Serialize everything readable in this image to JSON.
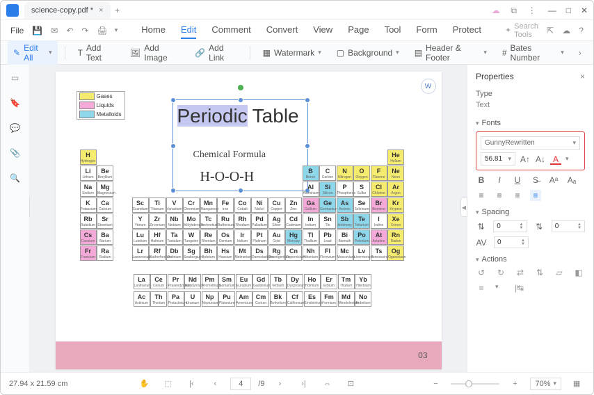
{
  "tab_title": "science-copy.pdf *",
  "menu": {
    "file": "File"
  },
  "tabs": [
    "Home",
    "Edit",
    "Comment",
    "Convert",
    "View",
    "Page",
    "Tool",
    "Form",
    "Protect"
  ],
  "active_tab": "Edit",
  "search_placeholder": "Search Tools",
  "toolbar": {
    "edit_all": "Edit All",
    "add_text": "Add Text",
    "add_image": "Add Image",
    "add_link": "Add Link",
    "watermark": "Watermark",
    "background": "Background",
    "header_footer": "Header & Footer",
    "bates": "Bates Number"
  },
  "properties": {
    "title": "Properties",
    "type_label": "Type",
    "type_value": "Text",
    "fonts_label": "Fonts",
    "font_name": "GunnyRewritten",
    "font_size": "56.81",
    "spacing_label": "Spacing",
    "spacing_before": "0",
    "spacing_after": "0",
    "char_spacing": "0",
    "actions_label": "Actions"
  },
  "doc": {
    "title_word1": "Periodic",
    "title_word2": "Table",
    "subtitle": "Chemical Formula",
    "formula": "H-O-O-H",
    "page_number": "03",
    "legend": {
      "gases": "Gases",
      "liquids": "Liquids",
      "metalloids": "Metalloids"
    },
    "elements_main": [
      {
        "s": "H",
        "n": "Hydrogen",
        "r": 0,
        "c": 0,
        "cat": "gas"
      },
      {
        "s": "He",
        "n": "Helium",
        "r": 0,
        "c": 17,
        "cat": "gas"
      },
      {
        "s": "Li",
        "n": "Lithium",
        "r": 1,
        "c": 0
      },
      {
        "s": "Be",
        "n": "Beryllium",
        "r": 1,
        "c": 1
      },
      {
        "s": "B",
        "n": "Boron",
        "r": 1,
        "c": 12,
        "cat": "met"
      },
      {
        "s": "C",
        "n": "Carbon",
        "r": 1,
        "c": 13
      },
      {
        "s": "N",
        "n": "Nitrogen",
        "r": 1,
        "c": 14,
        "cat": "gas"
      },
      {
        "s": "O",
        "n": "Oxygen",
        "r": 1,
        "c": 15,
        "cat": "gas"
      },
      {
        "s": "F",
        "n": "Fluorine",
        "r": 1,
        "c": 16,
        "cat": "gas"
      },
      {
        "s": "Ne",
        "n": "Neon",
        "r": 1,
        "c": 17,
        "cat": "gas"
      },
      {
        "s": "Na",
        "n": "Sodium",
        "r": 2,
        "c": 0
      },
      {
        "s": "Mg",
        "n": "Magnesium",
        "r": 2,
        "c": 1
      },
      {
        "s": "Al",
        "n": "Aluminium",
        "r": 2,
        "c": 12
      },
      {
        "s": "Si",
        "n": "Silicon",
        "r": 2,
        "c": 13,
        "cat": "met"
      },
      {
        "s": "P",
        "n": "Phosphorus",
        "r": 2,
        "c": 14
      },
      {
        "s": "S",
        "n": "Sulfur",
        "r": 2,
        "c": 15
      },
      {
        "s": "Cl",
        "n": "Chlorine",
        "r": 2,
        "c": 16,
        "cat": "gas"
      },
      {
        "s": "Ar",
        "n": "Argon",
        "r": 2,
        "c": 17,
        "cat": "gas"
      },
      {
        "s": "K",
        "n": "Potassium",
        "r": 3,
        "c": 0
      },
      {
        "s": "Ca",
        "n": "Calcium",
        "r": 3,
        "c": 1
      },
      {
        "s": "Sc",
        "n": "Scandium",
        "r": 3,
        "c": 2
      },
      {
        "s": "Ti",
        "n": "Titanium",
        "r": 3,
        "c": 3
      },
      {
        "s": "V",
        "n": "Vanadium",
        "r": 3,
        "c": 4
      },
      {
        "s": "Cr",
        "n": "Chromium",
        "r": 3,
        "c": 5
      },
      {
        "s": "Mn",
        "n": "Manganese",
        "r": 3,
        "c": 6
      },
      {
        "s": "Fe",
        "n": "Iron",
        "r": 3,
        "c": 7
      },
      {
        "s": "Co",
        "n": "Cobalt",
        "r": 3,
        "c": 8
      },
      {
        "s": "Ni",
        "n": "Nickel",
        "r": 3,
        "c": 9
      },
      {
        "s": "Cu",
        "n": "Copper",
        "r": 3,
        "c": 10
      },
      {
        "s": "Zn",
        "n": "Zinc",
        "r": 3,
        "c": 11
      },
      {
        "s": "Ga",
        "n": "Gallium",
        "r": 3,
        "c": 12,
        "cat": "liq"
      },
      {
        "s": "Ge",
        "n": "Germanium",
        "r": 3,
        "c": 13,
        "cat": "met"
      },
      {
        "s": "As",
        "n": "Arsenic",
        "r": 3,
        "c": 14,
        "cat": "met"
      },
      {
        "s": "Se",
        "n": "Selenium",
        "r": 3,
        "c": 15
      },
      {
        "s": "Br",
        "n": "Bromine",
        "r": 3,
        "c": 16,
        "cat": "liq"
      },
      {
        "s": "Kr",
        "n": "Krypton",
        "r": 3,
        "c": 17,
        "cat": "gas"
      },
      {
        "s": "Rb",
        "n": "Rubidium",
        "r": 4,
        "c": 0
      },
      {
        "s": "Sr",
        "n": "Strontium",
        "r": 4,
        "c": 1
      },
      {
        "s": "Y",
        "n": "Yttrium",
        "r": 4,
        "c": 2
      },
      {
        "s": "Zr",
        "n": "Zirconium",
        "r": 4,
        "c": 3
      },
      {
        "s": "Nb",
        "n": "Niobium",
        "r": 4,
        "c": 4
      },
      {
        "s": "Mo",
        "n": "Molybdenum",
        "r": 4,
        "c": 5
      },
      {
        "s": "Tc",
        "n": "Technetium",
        "r": 4,
        "c": 6
      },
      {
        "s": "Ru",
        "n": "Ruthenium",
        "r": 4,
        "c": 7
      },
      {
        "s": "Rh",
        "n": "Rhodium",
        "r": 4,
        "c": 8
      },
      {
        "s": "Pd",
        "n": "Palladium",
        "r": 4,
        "c": 9
      },
      {
        "s": "Ag",
        "n": "Silver",
        "r": 4,
        "c": 10
      },
      {
        "s": "Cd",
        "n": "Cadmium",
        "r": 4,
        "c": 11
      },
      {
        "s": "In",
        "n": "Indium",
        "r": 4,
        "c": 12
      },
      {
        "s": "Sn",
        "n": "Tin",
        "r": 4,
        "c": 13
      },
      {
        "s": "Sb",
        "n": "Antimony",
        "r": 4,
        "c": 14,
        "cat": "met"
      },
      {
        "s": "Te",
        "n": "Tellurium",
        "r": 4,
        "c": 15,
        "cat": "met"
      },
      {
        "s": "I",
        "n": "Iodine",
        "r": 4,
        "c": 16
      },
      {
        "s": "Xe",
        "n": "Xenon",
        "r": 4,
        "c": 17,
        "cat": "gas"
      },
      {
        "s": "Cs",
        "n": "Caesium",
        "r": 5,
        "c": 0,
        "cat": "liq"
      },
      {
        "s": "Ba",
        "n": "Barium",
        "r": 5,
        "c": 1
      },
      {
        "s": "Lu",
        "n": "Lutetium",
        "r": 5,
        "c": 2
      },
      {
        "s": "Hf",
        "n": "Hafnium",
        "r": 5,
        "c": 3
      },
      {
        "s": "Ta",
        "n": "Tantalum",
        "r": 5,
        "c": 4
      },
      {
        "s": "W",
        "n": "Tungsten",
        "r": 5,
        "c": 5
      },
      {
        "s": "Re",
        "n": "Rhenium",
        "r": 5,
        "c": 6
      },
      {
        "s": "Os",
        "n": "Osmium",
        "r": 5,
        "c": 7
      },
      {
        "s": "Ir",
        "n": "Iridium",
        "r": 5,
        "c": 8
      },
      {
        "s": "Pt",
        "n": "Platinum",
        "r": 5,
        "c": 9
      },
      {
        "s": "Au",
        "n": "Gold",
        "r": 5,
        "c": 10
      },
      {
        "s": "Hg",
        "n": "Mercury",
        "r": 5,
        "c": 11,
        "cat": "met"
      },
      {
        "s": "Tl",
        "n": "Thallium",
        "r": 5,
        "c": 12
      },
      {
        "s": "Pb",
        "n": "Lead",
        "r": 5,
        "c": 13
      },
      {
        "s": "Bi",
        "n": "Bismuth",
        "r": 5,
        "c": 14
      },
      {
        "s": "Po",
        "n": "Polonium",
        "r": 5,
        "c": 15,
        "cat": "met"
      },
      {
        "s": "At",
        "n": "Astatine",
        "r": 5,
        "c": 16,
        "cat": "liq"
      },
      {
        "s": "Rn",
        "n": "Radon",
        "r": 5,
        "c": 17,
        "cat": "gas"
      },
      {
        "s": "Fr",
        "n": "Francium",
        "r": 6,
        "c": 0,
        "cat": "liq"
      },
      {
        "s": "Ra",
        "n": "Radium",
        "r": 6,
        "c": 1
      },
      {
        "s": "Lr",
        "n": "Lawrencium",
        "r": 6,
        "c": 2
      },
      {
        "s": "Rf",
        "n": "Rutherfordium",
        "r": 6,
        "c": 3
      },
      {
        "s": "Db",
        "n": "Dubnium",
        "r": 6,
        "c": 4
      },
      {
        "s": "Sg",
        "n": "Seaborgium",
        "r": 6,
        "c": 5
      },
      {
        "s": "Bh",
        "n": "Bohrium",
        "r": 6,
        "c": 6
      },
      {
        "s": "Hs",
        "n": "Hassium",
        "r": 6,
        "c": 7
      },
      {
        "s": "Mt",
        "n": "Meitnerium",
        "r": 6,
        "c": 8
      },
      {
        "s": "Ds",
        "n": "Darmstadtium",
        "r": 6,
        "c": 9
      },
      {
        "s": "Rg",
        "n": "Roentgenium",
        "r": 6,
        "c": 10
      },
      {
        "s": "Cn",
        "n": "Copernicium",
        "r": 6,
        "c": 11
      },
      {
        "s": "Nh",
        "n": "Nihonium",
        "r": 6,
        "c": 12
      },
      {
        "s": "Fl",
        "n": "Flerovium",
        "r": 6,
        "c": 13
      },
      {
        "s": "Mc",
        "n": "Moscovium",
        "r": 6,
        "c": 14
      },
      {
        "s": "Lv",
        "n": "Livermorium",
        "r": 6,
        "c": 15
      },
      {
        "s": "Ts",
        "n": "Tennessine",
        "r": 6,
        "c": 16
      },
      {
        "s": "Og",
        "n": "Oganesson",
        "r": 6,
        "c": 17,
        "cat": "gas"
      }
    ],
    "elements_lanth": [
      {
        "s": "La",
        "n": "Lanthanum"
      },
      {
        "s": "Ce",
        "n": "Cerium"
      },
      {
        "s": "Pr",
        "n": "Praseodymium"
      },
      {
        "s": "Nd",
        "n": "Neodymium"
      },
      {
        "s": "Pm",
        "n": "Promethium"
      },
      {
        "s": "Sm",
        "n": "Samarium"
      },
      {
        "s": "Eu",
        "n": "Europium"
      },
      {
        "s": "Gd",
        "n": "Gadolinium"
      },
      {
        "s": "Tb",
        "n": "Terbium"
      },
      {
        "s": "Dy",
        "n": "Dysprosium"
      },
      {
        "s": "Ho",
        "n": "Holmium"
      },
      {
        "s": "Er",
        "n": "Erbium"
      },
      {
        "s": "Tm",
        "n": "Thulium"
      },
      {
        "s": "Yb",
        "n": "Ytterbium"
      }
    ],
    "elements_act": [
      {
        "s": "Ac",
        "n": "Actinium"
      },
      {
        "s": "Th",
        "n": "Thorium"
      },
      {
        "s": "Pa",
        "n": "Protactinium"
      },
      {
        "s": "U",
        "n": "Uranium"
      },
      {
        "s": "Np",
        "n": "Neptunium"
      },
      {
        "s": "Pu",
        "n": "Plutonium"
      },
      {
        "s": "Am",
        "n": "Americium"
      },
      {
        "s": "Cm",
        "n": "Curium"
      },
      {
        "s": "Bk",
        "n": "Berkelium"
      },
      {
        "s": "Cf",
        "n": "Californium"
      },
      {
        "s": "Es",
        "n": "Einsteinium"
      },
      {
        "s": "Fm",
        "n": "Fermium"
      },
      {
        "s": "Md",
        "n": "Mendelevium"
      },
      {
        "s": "No",
        "n": "Nobelium"
      }
    ]
  },
  "status": {
    "dims": "27.94 x 21.59 cm",
    "page_current": "4",
    "page_total": "/9",
    "zoom_pct": "70%"
  }
}
